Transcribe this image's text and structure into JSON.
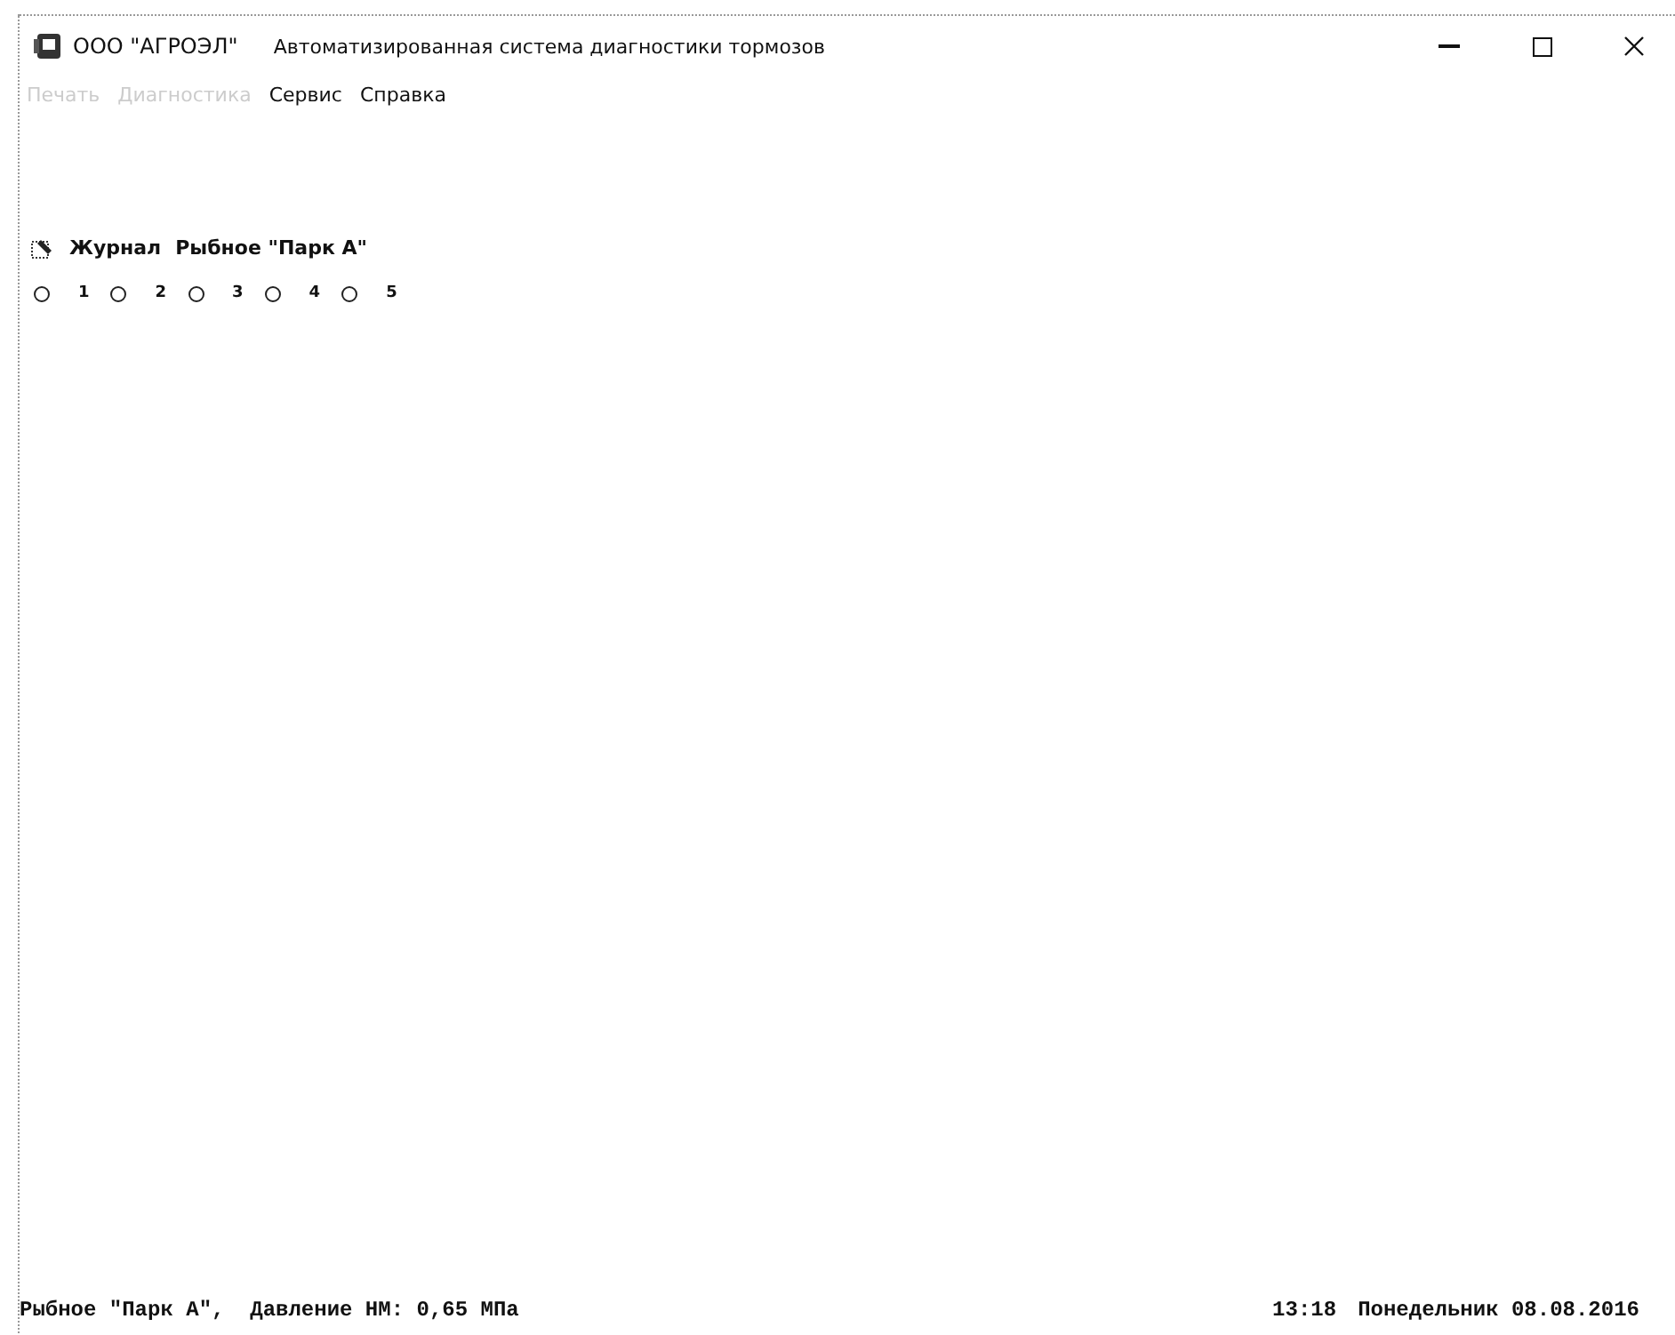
{
  "window": {
    "company": "ООО \"АГРОЭЛ\"",
    "title": "Автоматизированная система диагностики тормозов"
  },
  "menu": [
    {
      "label": "Печать",
      "disabled": true
    },
    {
      "label": "Диагностика",
      "disabled": true
    },
    {
      "label": "Сервис",
      "disabled": false
    },
    {
      "label": "Справка",
      "disabled": false
    }
  ],
  "toolbar": {
    "journal": "Журнал",
    "location": "Рыбное \"Парк А\""
  },
  "radios": [
    {
      "label": "1",
      "selected": false
    },
    {
      "label": "2",
      "selected": false
    },
    {
      "label": "3",
      "selected": false
    },
    {
      "label": "4",
      "selected": false
    },
    {
      "label": "5",
      "selected": false
    }
  ],
  "status_bar": {
    "left": "Рыбное \"Парк А\",  Давление НМ: 0,65 МПа",
    "time": "13:18",
    "date": "Понедельник 08.08.2016"
  }
}
